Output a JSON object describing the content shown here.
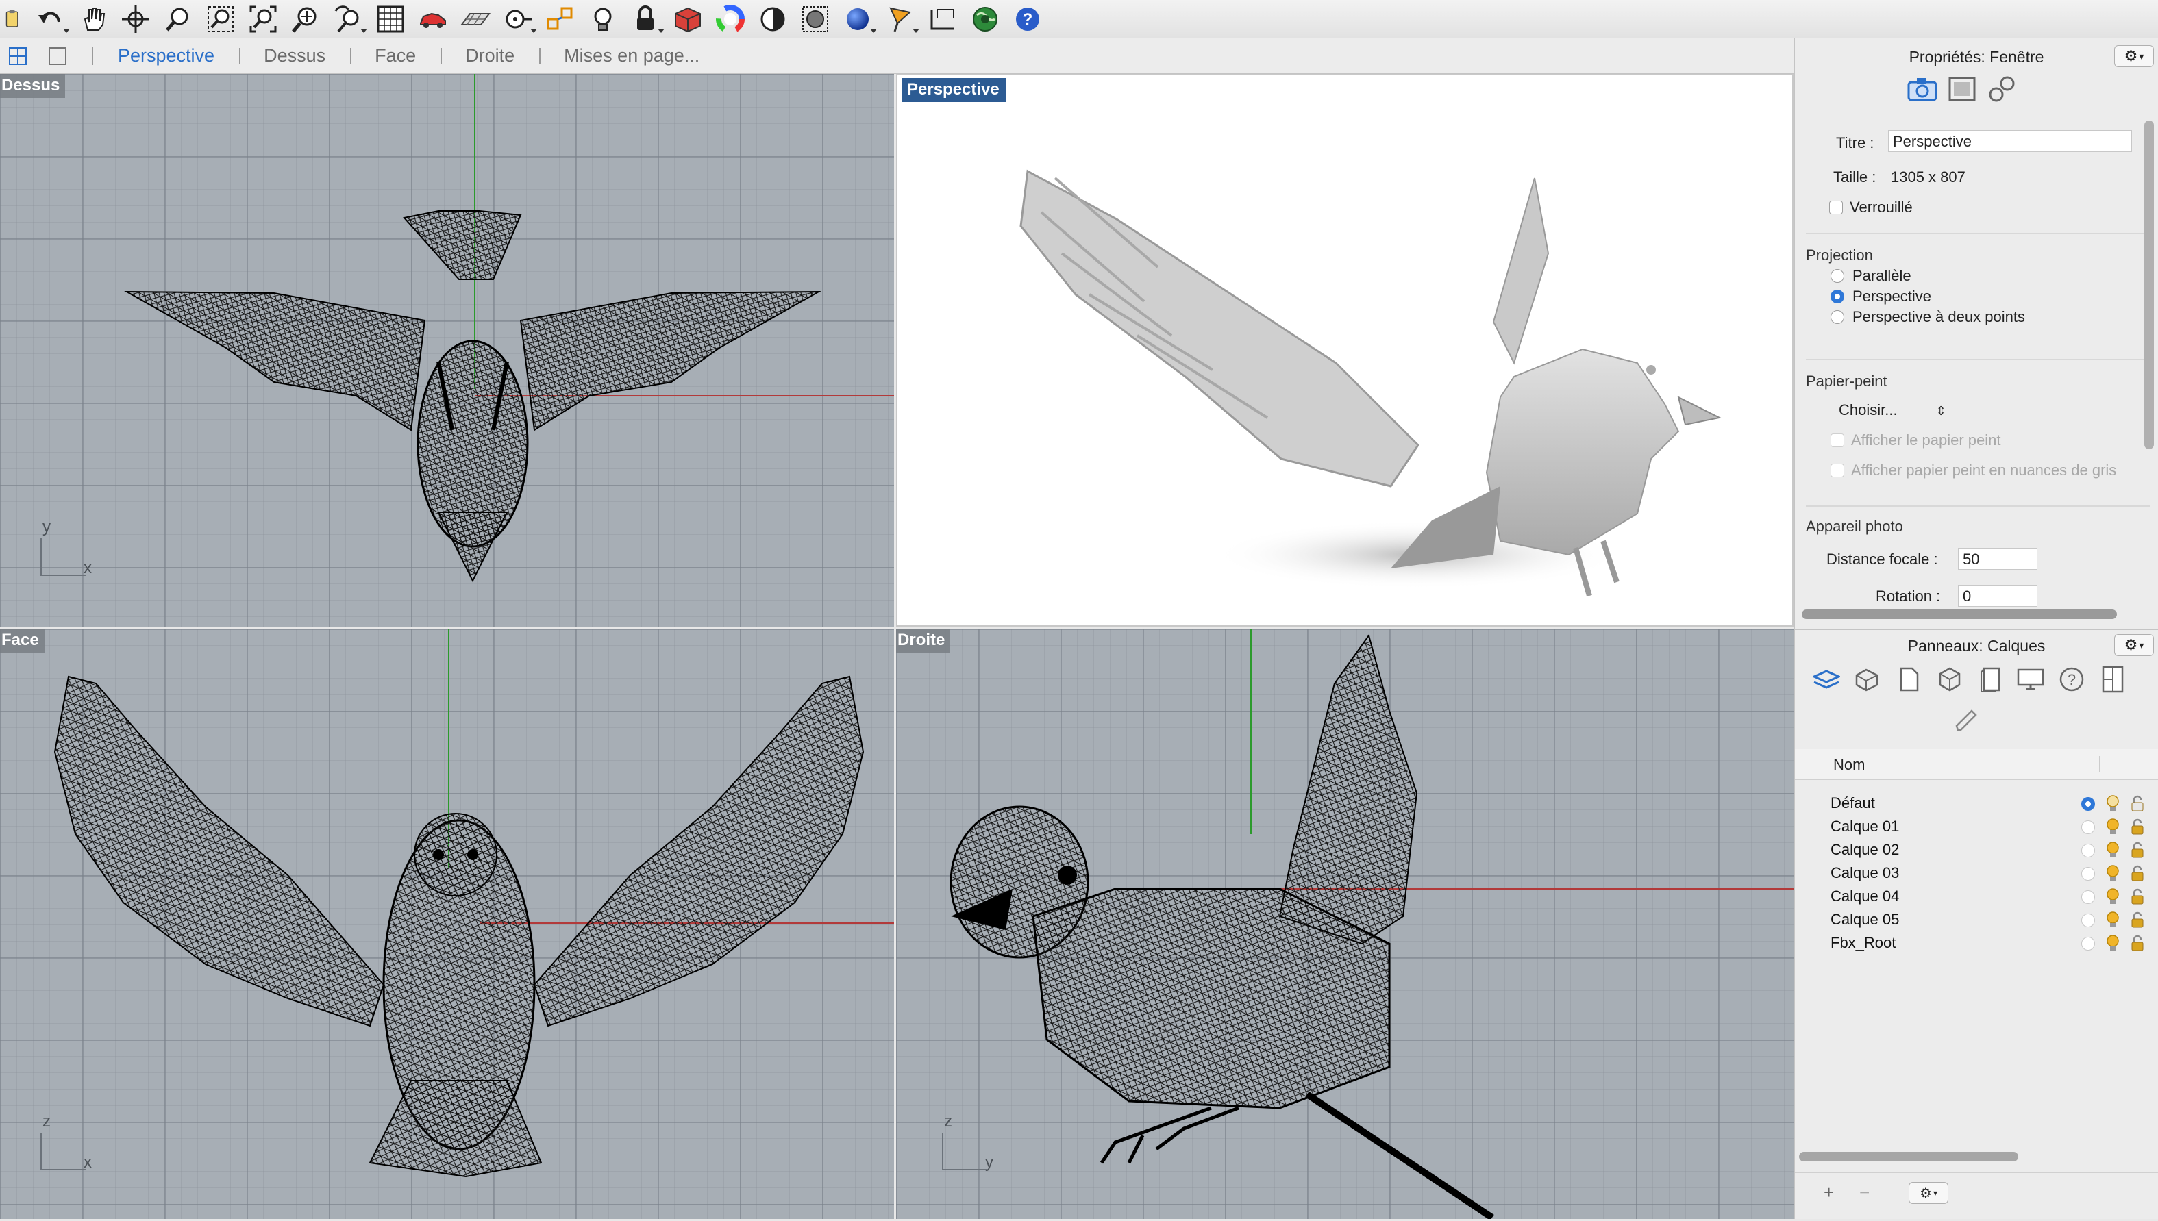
{
  "toolbar": {
    "icons": [
      "notes-icon",
      "undo-icon",
      "pan-hand-icon",
      "rotate-view-icon",
      "zoom-icon",
      "zoom-window-icon",
      "zoom-extents-icon",
      "zoom-selected-icon",
      "undo-view-icon",
      "four-viewports-icon",
      "car-icon",
      "plane-grid-icon",
      "target-icon",
      "snap-icon",
      "bulb-icon",
      "lock-icon",
      "layers-icon",
      "color-wheel-icon",
      "shade-sphere-icon",
      "render-preview-icon",
      "render-sphere-icon",
      "flag-icon",
      "dimension-icon",
      "globe-icon",
      "help-icon"
    ]
  },
  "tabs": {
    "items": [
      "Perspective",
      "Dessus",
      "Face",
      "Droite",
      "Mises en page..."
    ],
    "active": "Perspective"
  },
  "viewports": {
    "top_left": {
      "label": "Dessus",
      "axis_v": "y",
      "axis_h": "x"
    },
    "top_right": {
      "label": "Perspective"
    },
    "bottom_left": {
      "label": "Face",
      "axis_v": "z",
      "axis_h": "x"
    },
    "bottom_right": {
      "label": "Droite",
      "axis_v": "z",
      "axis_h": "y"
    }
  },
  "properties": {
    "title": "Propriétés: Fenêtre",
    "gear": "⚙",
    "titre_label": "Titre :",
    "titre_value": "Perspective",
    "taille_label": "Taille :",
    "taille_value": "1305 x 807",
    "verrouille_label": "Verrouillé",
    "projection_heading": "Projection",
    "projection_options": [
      "Parallèle",
      "Perspective",
      "Perspective à deux points"
    ],
    "projection_selected": "Perspective",
    "papier_heading": "Papier-peint",
    "choisir_label": "Choisir...",
    "show_wallpaper": "Afficher le papier peint",
    "show_wallpaper_gray": "Afficher papier peint en nuances de gris",
    "camera_heading": "Appareil photo",
    "focal_label": "Distance focale :",
    "focal_value": "50",
    "rotation_label": "Rotation :",
    "rotation_value": "0"
  },
  "layers": {
    "title": "Panneaux: Calques",
    "gear": "⚙",
    "column_name": "Nom",
    "rows": [
      {
        "name": "Défaut",
        "current": true
      },
      {
        "name": "Calque 01",
        "current": false
      },
      {
        "name": "Calque 02",
        "current": false
      },
      {
        "name": "Calque 03",
        "current": false
      },
      {
        "name": "Calque 04",
        "current": false
      },
      {
        "name": "Calque 05",
        "current": false
      },
      {
        "name": "Fbx_Root",
        "current": false
      }
    ],
    "add_label": "+",
    "remove_label": "−",
    "colors": {
      "current": "#2f78d8",
      "bulb": "#f0b429",
      "lock": "#d9a520"
    }
  }
}
